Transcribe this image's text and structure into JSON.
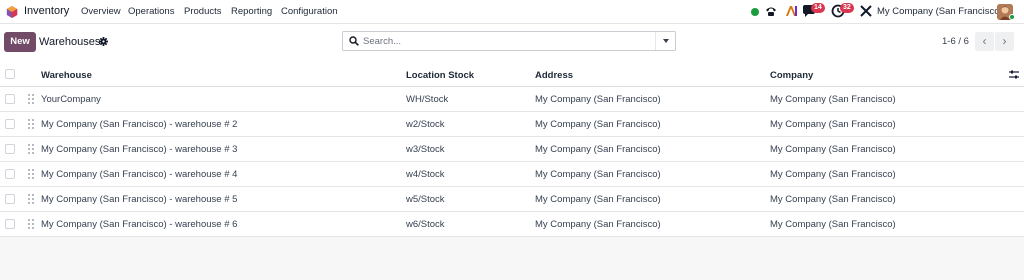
{
  "navbar": {
    "app_name": "Inventory",
    "menu": [
      "Overview",
      "Operations",
      "Products",
      "Reporting",
      "Configuration"
    ],
    "messages_count": "14",
    "activities_count": "32",
    "company_name": "My Company (San Francisco)"
  },
  "control": {
    "new_label": "New",
    "title": "Warehouses",
    "search_placeholder": "Search...",
    "pager_text": "1-6 / 6"
  },
  "table": {
    "headers": [
      "Warehouse",
      "Location Stock",
      "Address",
      "Company"
    ],
    "rows": [
      [
        "YourCompany",
        "WH/Stock",
        "My Company (San Francisco)",
        "My Company (San Francisco)"
      ],
      [
        "My Company (San Francisco) - warehouse # 2",
        "w2/Stock",
        "My Company (San Francisco)",
        "My Company (San Francisco)"
      ],
      [
        "My Company (San Francisco) - warehouse # 3",
        "w3/Stock",
        "My Company (San Francisco)",
        "My Company (San Francisco)"
      ],
      [
        "My Company (San Francisco) - warehouse # 4",
        "w4/Stock",
        "My Company (San Francisco)",
        "My Company (San Francisco)"
      ],
      [
        "My Company (San Francisco) - warehouse # 5",
        "w5/Stock",
        "My Company (San Francisco)",
        "My Company (San Francisco)"
      ],
      [
        "My Company (San Francisco) - warehouse # 6",
        "w6/Stock",
        "My Company (San Francisco)",
        "My Company (San Francisco)"
      ]
    ]
  },
  "colors": {
    "brand": "#714b67",
    "badge": "#d9364f",
    "status_online": "#1a9c3f"
  },
  "icons": [
    "app-logo-icon",
    "phone-icon",
    "ai-icon",
    "chat-icon",
    "clock-icon",
    "tools-icon",
    "gear-icon",
    "search-icon",
    "caret-down-icon",
    "chevron-left-icon",
    "chevron-right-icon",
    "optional-columns-icon",
    "drag-handle-icon"
  ]
}
